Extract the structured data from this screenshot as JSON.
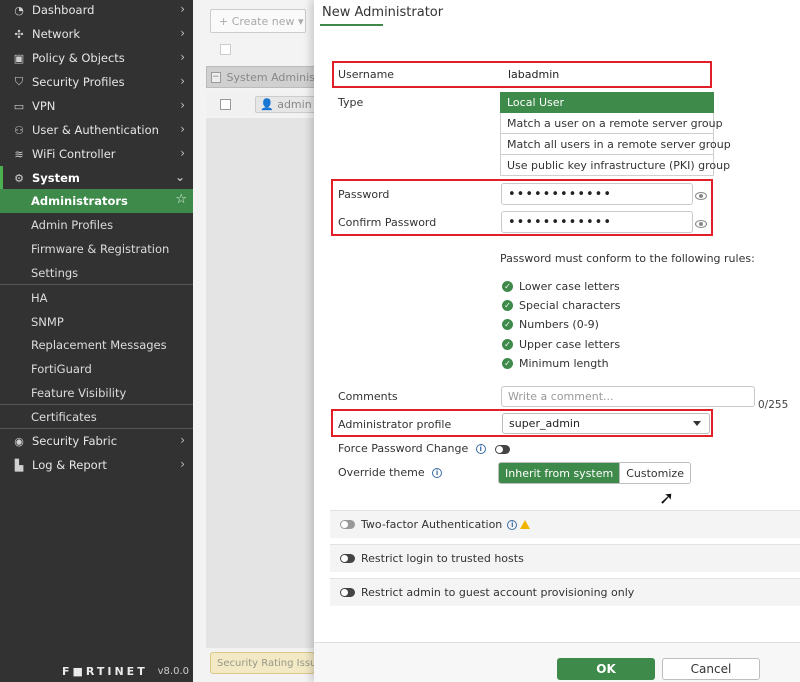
{
  "sidebar": {
    "items": [
      {
        "label": "Dashboard",
        "icon": "dashboard-icon",
        "glyph": "◔"
      },
      {
        "label": "Network",
        "icon": "network-icon",
        "glyph": "✣"
      },
      {
        "label": "Policy & Objects",
        "icon": "lock-icon",
        "glyph": "▣"
      },
      {
        "label": "Security Profiles",
        "icon": "shield-icon",
        "glyph": "⛉"
      },
      {
        "label": "VPN",
        "icon": "monitor-icon",
        "glyph": "▭"
      },
      {
        "label": "User & Authentication",
        "icon": "user-icon",
        "glyph": "⚇"
      },
      {
        "label": "WiFi Controller",
        "icon": "wifi-icon",
        "glyph": "≋"
      },
      {
        "label": "System",
        "icon": "gear-icon",
        "glyph": "⚙"
      }
    ],
    "system_sub": [
      "Administrators",
      "Admin Profiles",
      "Firmware & Registration",
      "Settings",
      "HA",
      "SNMP",
      "Replacement Messages",
      "FortiGuard",
      "Feature Visibility",
      "Certificates"
    ],
    "bottom_items": [
      {
        "label": "Security Fabric",
        "icon": "fabric-icon",
        "glyph": "◉"
      },
      {
        "label": "Log & Report",
        "icon": "chart-icon",
        "glyph": "▙"
      }
    ],
    "brand": "F■RTINET",
    "version": "v8.0.0"
  },
  "background": {
    "create_new": "+ Create new ▾",
    "table_title": "System Administrators",
    "row_name": "admin",
    "security_rating": "Security Rating Issues"
  },
  "dialog": {
    "title": "New Administrator",
    "username_label": "Username",
    "username_value": "labadmin",
    "type_label": "Type",
    "type_options": [
      "Local User",
      "Match a user on a remote server group",
      "Match all users in a remote server group",
      "Use public key infrastructure (PKI) group"
    ],
    "password_label": "Password",
    "password_value": "••••••••••••",
    "confirm_label": "Confirm Password",
    "confirm_value": "••••••••••••",
    "rules_title": "Password must conform to the following rules:",
    "rules": [
      "Lower case letters",
      "Special characters",
      "Numbers (0-9)",
      "Upper case letters",
      "Minimum length"
    ],
    "comments_label": "Comments",
    "comments_placeholder": "Write a comment...",
    "comments_count": "0/255",
    "profile_label": "Administrator profile",
    "profile_value": "super_admin",
    "force_label": "Force Password Change",
    "theme_label": "Override theme",
    "theme_on": "Inherit from system",
    "theme_off": "Customize",
    "two_factor": "Two-factor Authentication",
    "restrict_hosts": "Restrict login to trusted hosts",
    "restrict_guest": "Restrict admin to guest account provisioning only",
    "ok": "OK",
    "cancel": "Cancel"
  },
  "colors": {
    "accent": "#3e8a4a",
    "highlight": "#e01f26",
    "sidebar": "#323232"
  }
}
